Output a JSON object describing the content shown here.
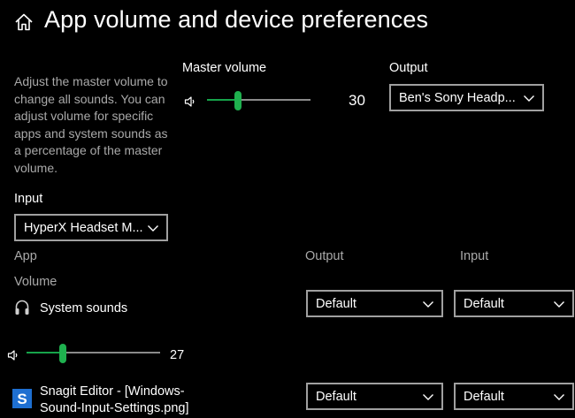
{
  "header": {
    "title": "App volume and device preferences"
  },
  "description": "Adjust the master volume to change all sounds. You can adjust volume for specific apps and system sounds as a percentage of the master volume.",
  "master": {
    "label": "Master volume",
    "value": "30",
    "level": 30,
    "output_label": "Output",
    "output_value": "Ben's Sony Headp..."
  },
  "input": {
    "label": "Input",
    "value": "HyperX Headset M..."
  },
  "columns": {
    "app": "App",
    "volume": "Volume",
    "output": "Output",
    "input": "Input"
  },
  "apps": [
    {
      "name": "System sounds",
      "volume": "27",
      "level": 27,
      "output": "Default",
      "input": "Default"
    },
    {
      "name": "Snagit Editor - [Windows-Sound-Input-Settings.png]",
      "output": "Default",
      "input": "Default"
    }
  ],
  "colors": {
    "accent": "#1fb14f",
    "background": "#000000",
    "border": "#a0a0a0",
    "muted_text": "#a9a9a9"
  },
  "icons": {
    "home": "home-icon",
    "speaker": "speaker-icon",
    "headphones": "headphones-icon",
    "snagit": "snagit-icon",
    "chevron": "chevron-down-icon"
  }
}
